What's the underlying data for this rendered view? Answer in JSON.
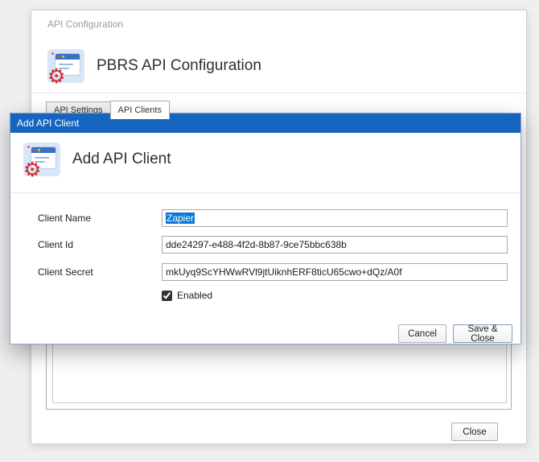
{
  "background_window": {
    "window_title": "API Configuration",
    "heading": "PBRS API Configuration",
    "tabs": [
      {
        "label": "API Settings"
      },
      {
        "label": "API Clients"
      }
    ],
    "close_label": "Close"
  },
  "dialog": {
    "title": "Add API Client",
    "heading": "Add API Client",
    "fields": [
      {
        "label": "Client Name",
        "value": "Zapier"
      },
      {
        "label": "Client Id",
        "value": "dde24297-e488-4f2d-8b87-9ce75bbc638b"
      },
      {
        "label": "Client Secret",
        "value": "mkUyq9ScYHWwRVl9jtUiknhERF8ticU65cwo+dQz/A0f"
      }
    ],
    "enabled": {
      "label": "Enabled",
      "checked": true
    },
    "buttons": {
      "cancel": "Cancel",
      "save": "Save & Close"
    }
  },
  "icons": {
    "gear": "⚙"
  },
  "colors": {
    "titlebar_blue": "#1565c0",
    "selection_blue": "#0a78d7",
    "gear_red": "#d22f2f",
    "icon_bg": "#d9e6f7",
    "icon_window_blue": "#3a72c2"
  }
}
